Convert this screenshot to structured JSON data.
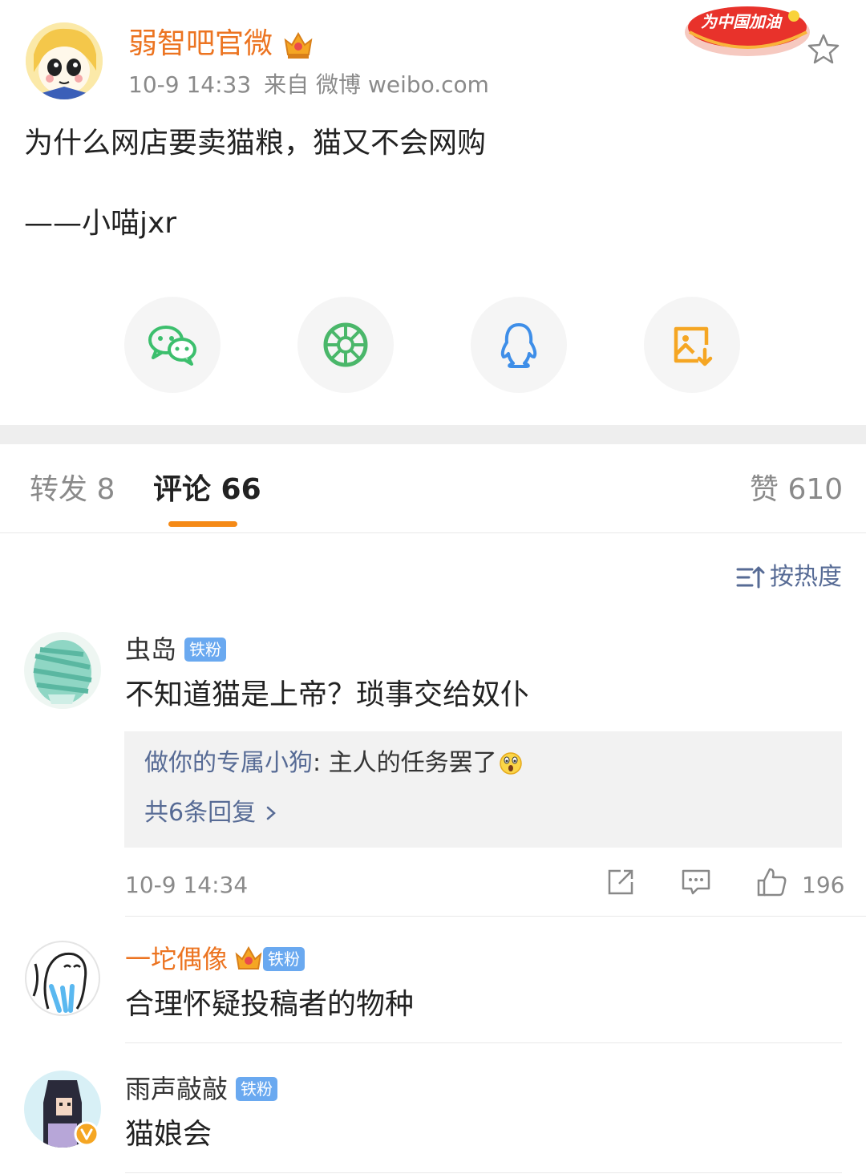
{
  "post": {
    "author": "弱智吧官微",
    "time": "10-9 14:33",
    "source": "来自 微博 weibo.com",
    "cheer_badge": "为中国加油",
    "text": "为什么网店要卖猫粮，猫又不会网购",
    "signature": "——小喵jxr"
  },
  "share": {
    "items": [
      {
        "name": "wechat-icon",
        "color": "#3cbf6d"
      },
      {
        "name": "moments-icon",
        "color": "#4ab76a"
      },
      {
        "name": "qq-icon",
        "color": "#3e8ee8"
      },
      {
        "name": "save-image-icon",
        "color": "#f5a623"
      }
    ]
  },
  "tabs": {
    "repost": "转发 8",
    "comments": "评论 66",
    "likes": "赞 610"
  },
  "sort_label": "按热度",
  "comments": [
    {
      "user": "虫岛",
      "badge": "铁粉",
      "text": "不知道猫是上帝？琐事交给奴仆",
      "reply_user": "做你的专属小狗",
      "reply_text": ": 主人的任务罢了",
      "reply_more": "共6条回复",
      "time": "10-9 14:34",
      "likes": "196"
    },
    {
      "user": "一坨偶像",
      "badge": "铁粉",
      "text": "合理怀疑投稿者的物种"
    },
    {
      "user": "雨声敲敲",
      "badge": "铁粉",
      "text": "猫娘会"
    }
  ],
  "colors": {
    "accent": "#f58a17",
    "link": "#576b95",
    "gold_name": "#ec7421",
    "badge_blue": "#6aa9f0"
  }
}
